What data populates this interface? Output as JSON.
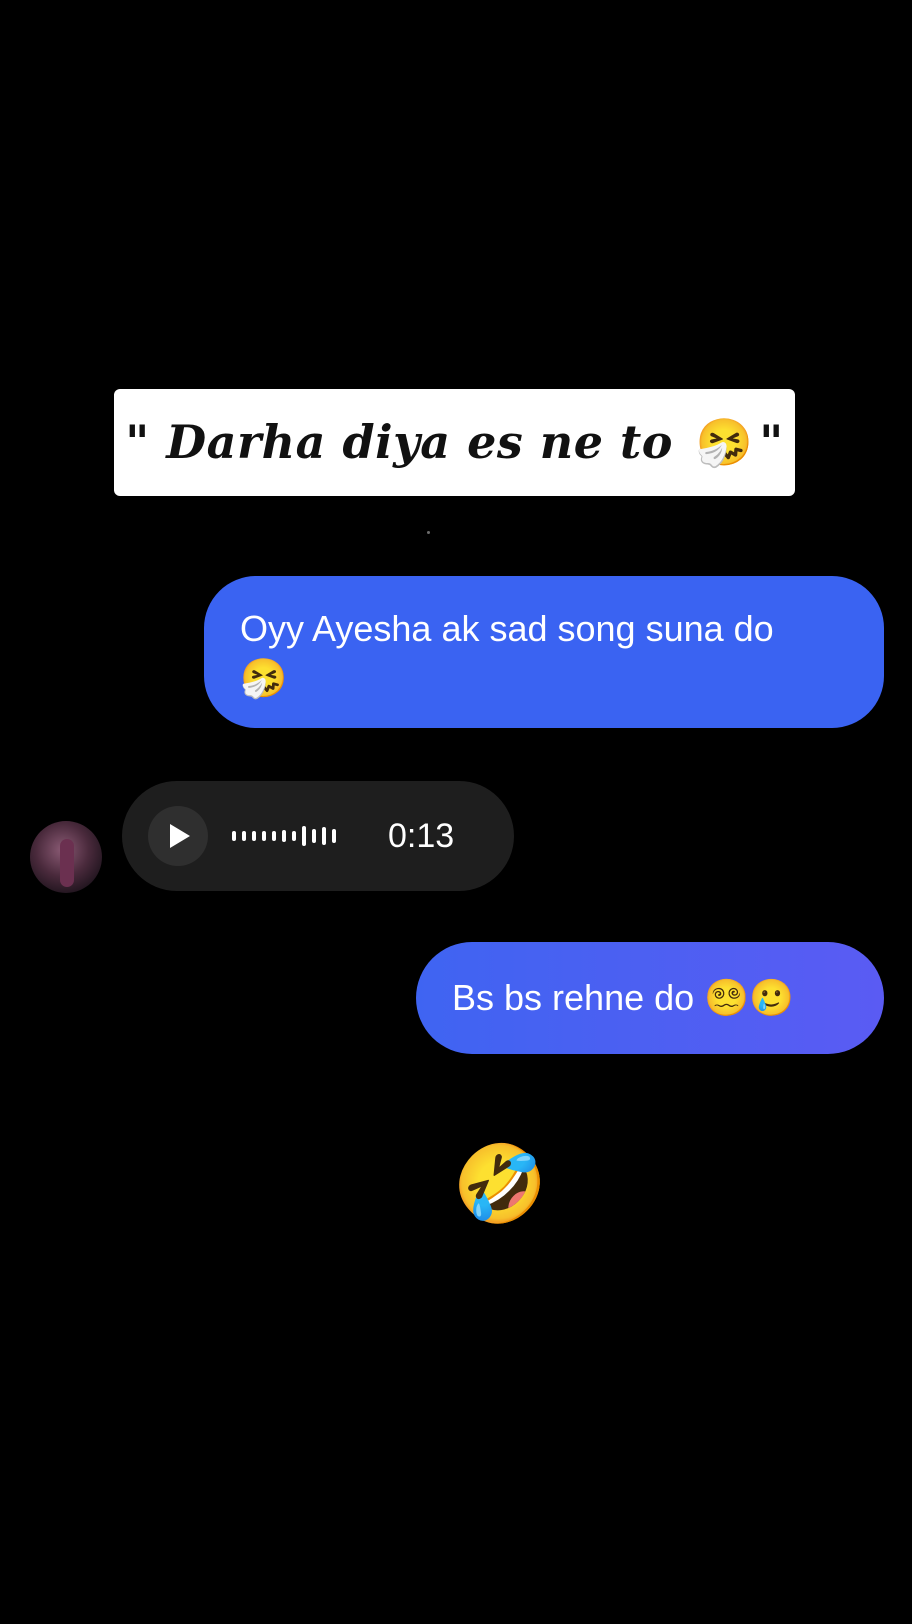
{
  "caption": {
    "text": "\" Darha diya es ne to ",
    "emoji": "🤧",
    "closing_quote": "\""
  },
  "messages": [
    {
      "direction": "outgoing",
      "text": "Oyy Ayesha ak sad song suna do",
      "emoji": "🤧"
    },
    {
      "direction": "incoming",
      "type": "voice",
      "duration": "0:13"
    },
    {
      "direction": "outgoing",
      "text": "Bs bs rehne do 😵‍💫🥲"
    }
  ],
  "reaction": {
    "emojis": "😂🤣"
  },
  "colors": {
    "background": "#000000",
    "outgoing_bubble": "#3a63f2",
    "incoming_bubble": "#1e1e1e",
    "caption_background": "#ffffff"
  },
  "icons": {
    "play": "play-icon",
    "waveform": "waveform-icon"
  }
}
